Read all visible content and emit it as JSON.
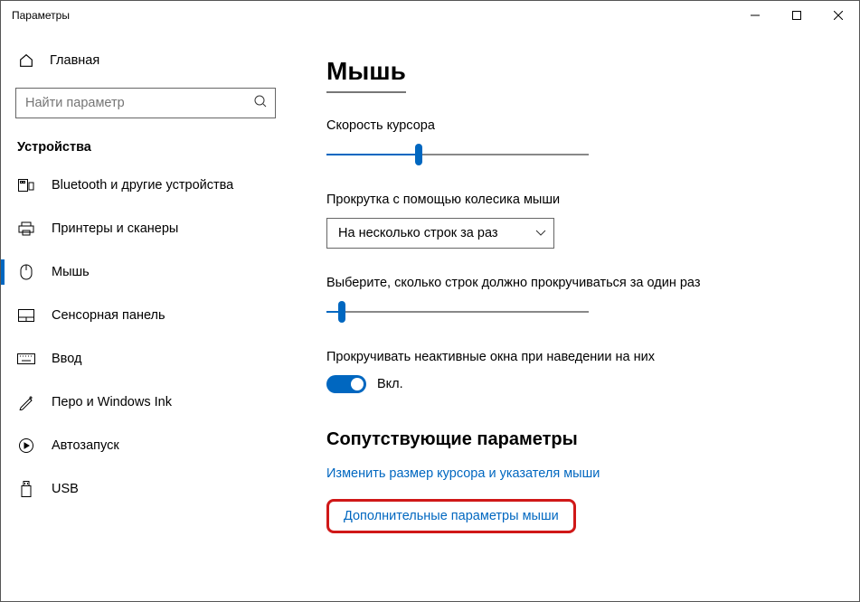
{
  "window": {
    "title": "Параметры"
  },
  "sidebar": {
    "home": "Главная",
    "search_placeholder": "Найти параметр",
    "section": "Устройства",
    "items": [
      {
        "label": "Bluetooth и другие устройства"
      },
      {
        "label": "Принтеры и сканеры"
      },
      {
        "label": "Мышь"
      },
      {
        "label": "Сенсорная панель"
      },
      {
        "label": "Ввод"
      },
      {
        "label": "Перо и Windows Ink"
      },
      {
        "label": "Автозапуск"
      },
      {
        "label": "USB"
      }
    ]
  },
  "content": {
    "title": "Мышь",
    "cursor_speed_label": "Скорость курсора",
    "cursor_speed_value_pct": 35,
    "scroll_label": "Прокрутка с помощью колесика мыши",
    "scroll_selected": "На несколько строк за раз",
    "lines_label": "Выберите, сколько строк должно прокручиваться за один раз",
    "lines_value_pct": 6,
    "inactive_label": "Прокручивать неактивные окна при наведении на них",
    "inactive_toggle_on": true,
    "toggle_text": "Вкл.",
    "related_heading": "Сопутствующие параметры",
    "link_cursor_size": "Изменить размер курсора и указателя мыши",
    "link_additional": "Дополнительные параметры мыши"
  }
}
